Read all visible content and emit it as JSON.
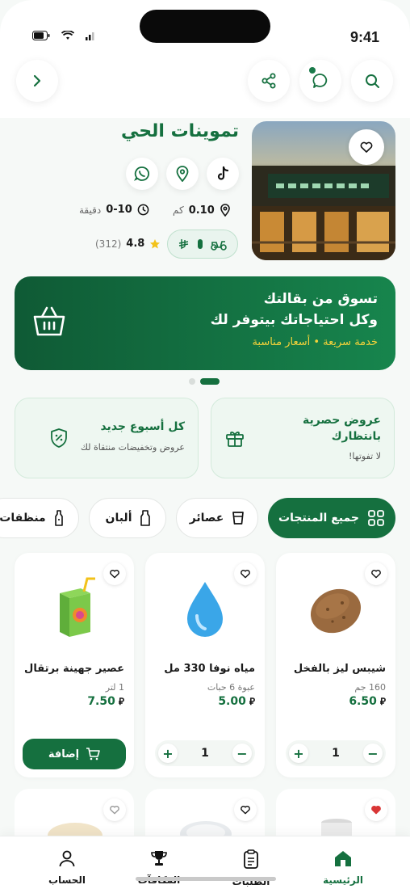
{
  "status": {
    "time": "9:41"
  },
  "store": {
    "title": "تموينات الحي",
    "distance_value": "0.10",
    "distance_unit": "كم",
    "time_value": "0-10",
    "time_unit": "دقيقة",
    "rating": "4.8",
    "reviews": "(312)"
  },
  "banner": {
    "line1": "تسوق من بقالتك",
    "line2": "وكل احتياجاتك بيتوفر لك",
    "line3": "خدمة سريعة • أسعار مناسبة"
  },
  "promos": [
    {
      "title": "عروض حصرية بانتظارك",
      "subtitle": "لا تفوتها!"
    },
    {
      "title": "كل أسبوع جديد",
      "subtitle": "عروض وتخفيضات منتقاة لك"
    }
  ],
  "categories": [
    {
      "label": "جميع المنتجات",
      "icon": "grid-icon"
    },
    {
      "label": "عصائر",
      "icon": "cup-icon"
    },
    {
      "label": "ألبان",
      "icon": "milk-bottle-icon"
    },
    {
      "label": "منظفات",
      "icon": "spray-bottle-icon"
    }
  ],
  "products": [
    {
      "name": "شيبس ليز بالفخل",
      "unit": "160 جم",
      "price": "6.50",
      "qty": "1",
      "icon": "potato-icon"
    },
    {
      "name": "مياه نوفا 330 مل",
      "unit": "عبوة 6 حبات",
      "price": "5.00",
      "qty": "1",
      "icon": "water-drop-icon"
    },
    {
      "name": "عصير جهينة برتقال",
      "unit": "1 لتر",
      "price": "7.50",
      "add_label": "إضافة",
      "icon": "juice-box-icon"
    }
  ],
  "nav": [
    {
      "label": "الرئيسية",
      "icon": "home-icon"
    },
    {
      "label": "الطلبات",
      "icon": "clipboard-icon"
    },
    {
      "label": "المكافآت",
      "icon": "trophy-icon"
    },
    {
      "label": "الحساب",
      "icon": "user-icon"
    }
  ],
  "colors": {
    "accent": "#15703f",
    "accent_light": "#eef7f1",
    "highlight": "#f4d23a"
  }
}
